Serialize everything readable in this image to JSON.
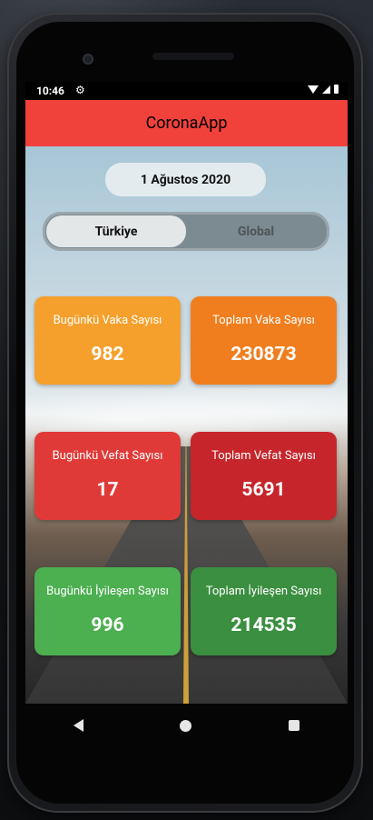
{
  "status_bar": {
    "time": "10:46",
    "icons": [
      "gear-icon",
      "wifi-icon",
      "signal-icon",
      "battery-icon"
    ]
  },
  "app": {
    "title": "CoronaApp",
    "date": "1 Ağustos 2020"
  },
  "segmented": {
    "active": "Türkiye",
    "inactive": "Global"
  },
  "cards": [
    {
      "label": "Bugünkü Vaka Sayısı",
      "value": "982",
      "color": "#f5a02c"
    },
    {
      "label": "Toplam Vaka Sayısı",
      "value": "230873",
      "color": "#f07e1e"
    },
    {
      "label": "Bugünkü Vefat Sayısı",
      "value": "17",
      "color": "#e03a38"
    },
    {
      "label": "Toplam Vefat Sayısı",
      "value": "5691",
      "color": "#c6262b"
    },
    {
      "label": "Bugünkü İyileşen Sayısı",
      "value": "996",
      "color": "#4caf50"
    },
    {
      "label": "Toplam İyileşen Sayısı",
      "value": "214535",
      "color": "#3b8f40"
    }
  ],
  "colors": {
    "app_bar": "#f1413b"
  },
  "nav": [
    "back-icon",
    "home-icon",
    "recents-icon"
  ]
}
